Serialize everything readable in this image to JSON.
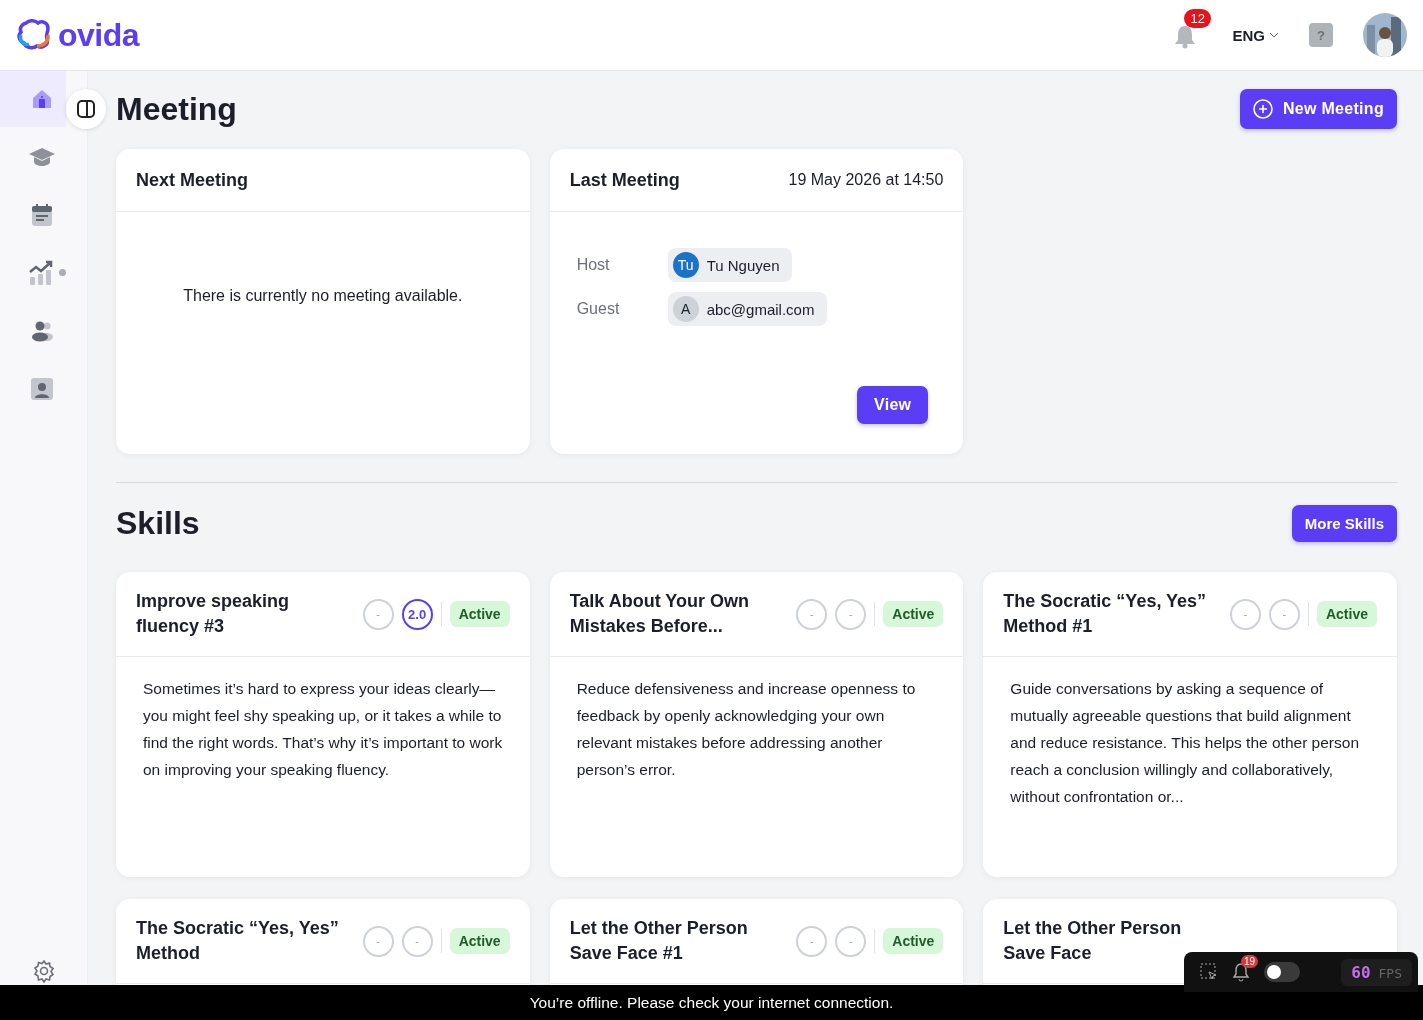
{
  "header": {
    "logo": "ovida",
    "notifications": "12",
    "language": "ENG",
    "help": "?"
  },
  "sidebar": {
    "items": [
      {
        "selected": true
      },
      {
        "selected": false
      },
      {
        "selected": false
      },
      {
        "selected": false,
        "dot": true
      },
      {
        "selected": false
      },
      {
        "selected": false
      }
    ]
  },
  "meeting": {
    "title": "Meeting",
    "new_button": "New Meeting",
    "next": {
      "title": "Next Meeting",
      "empty": "There is currently no meeting available."
    },
    "last": {
      "title": "Last Meeting",
      "date": "19 May 2026 at 14:50",
      "people": [
        {
          "label": "Host",
          "initials": "Tu",
          "name": "Tu Nguyen",
          "color": "#1a73c8"
        },
        {
          "label": "Guest",
          "initials": "A",
          "name": "abc@gmail.com",
          "color": "#cdd1d8"
        }
      ],
      "view_button": "View"
    }
  },
  "skills": {
    "title": "Skills",
    "more_button": "More Skills",
    "cards": [
      {
        "title": "Improve speaking fluency #3",
        "scores": [
          {
            "value": "-",
            "active": false
          },
          {
            "value": "2.0",
            "active": true
          }
        ],
        "status": "Active",
        "description": "Sometimes it’s hard to express your ideas clearly—you might feel shy speaking up, or it takes a while to find the right words. That’s why it’s important to work on improving your speaking fluency."
      },
      {
        "title": "Talk About Your Own Mistakes Before...",
        "scores": [
          {
            "value": "-",
            "active": false
          },
          {
            "value": "-",
            "active": false
          }
        ],
        "status": "Active",
        "description": "Reduce defensiveness and increase openness to feedback by openly acknowledging your own relevant mistakes before addressing another person’s error."
      },
      {
        "title": "The Socratic “Yes, Yes” Method #1",
        "scores": [
          {
            "value": "-",
            "active": false
          },
          {
            "value": "-",
            "active": false
          }
        ],
        "status": "Active",
        "description": "Guide conversations by asking a sequence of mutually agreeable questions that build alignment and reduce resistance. This helps the other person reach a conclusion willingly and collaboratively, without confrontation or..."
      },
      {
        "title": "The Socratic “Yes, Yes” Method",
        "scores": [
          {
            "value": "-",
            "active": false
          },
          {
            "value": "-",
            "active": false
          }
        ],
        "status": "Active"
      },
      {
        "title": "Let the Other Person Save Face #1",
        "scores": [
          {
            "value": "-",
            "active": false
          },
          {
            "value": "-",
            "active": false
          }
        ],
        "status": "Active"
      },
      {
        "title": "Let the Other Person Save Face"
      }
    ]
  },
  "dev_toolbar": {
    "notifications": "19",
    "toggle_on": false,
    "fps": "60",
    "fps_label": "FPS"
  },
  "offline_banner": "You’re offline. Please check your internet connection."
}
